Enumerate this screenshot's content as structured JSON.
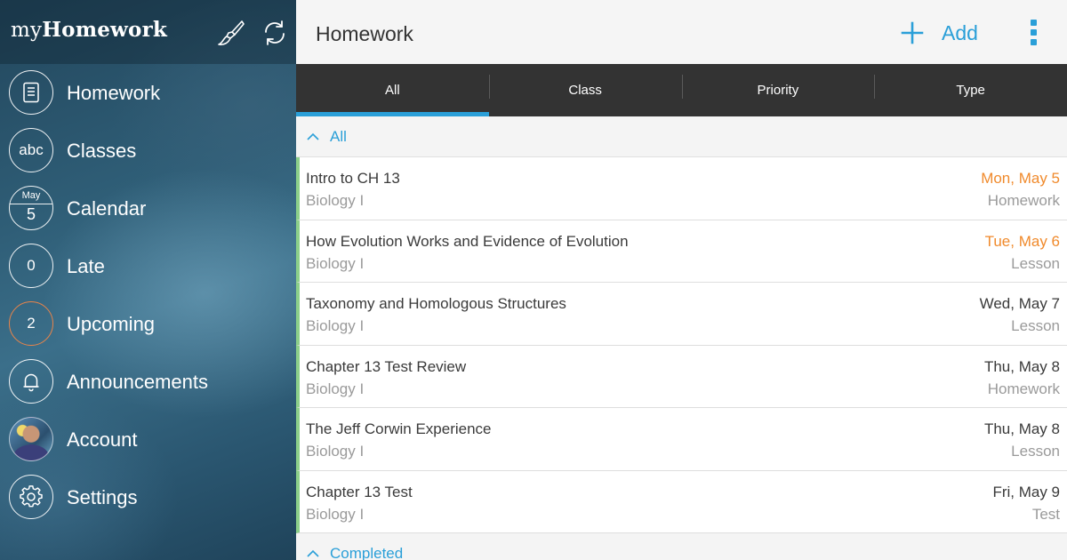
{
  "sidebar": {
    "brand_light": "my",
    "brand_bold": "Homework",
    "header_icons": [
      "paintbrush-icon",
      "sync-icon"
    ],
    "items": [
      {
        "id": "homework",
        "label": "Homework",
        "icon": "homework-list-icon"
      },
      {
        "id": "classes",
        "label": "Classes",
        "badge": "abc"
      },
      {
        "id": "calendar",
        "label": "Calendar",
        "cal_month": "May",
        "cal_day": "5"
      },
      {
        "id": "late",
        "label": "Late",
        "count": "0"
      },
      {
        "id": "upcoming",
        "label": "Upcoming",
        "count": "2",
        "count_color": "#e8844a"
      },
      {
        "id": "announcements",
        "label": "Announcements",
        "icon": "bell-icon"
      },
      {
        "id": "account",
        "label": "Account",
        "icon": "avatar"
      },
      {
        "id": "settings",
        "label": "Settings",
        "icon": "gear-icon"
      }
    ]
  },
  "header": {
    "title": "Homework",
    "add_label": "Add",
    "more_icon": "more-vertical-icon"
  },
  "tabs": [
    {
      "label": "All",
      "active": true
    },
    {
      "label": "Class",
      "active": false
    },
    {
      "label": "Priority",
      "active": false
    },
    {
      "label": "Type",
      "active": false
    }
  ],
  "sections": {
    "all_label": "All",
    "completed_label": "Completed"
  },
  "rows": [
    {
      "title": "Intro to CH 13",
      "class": "Biology I",
      "date": "Mon, May 5",
      "type": "Homework",
      "due_soon": true
    },
    {
      "title": "How Evolution Works and Evidence of Evolution",
      "class": "Biology I",
      "date": "Tue, May 6",
      "type": "Lesson",
      "due_soon": true
    },
    {
      "title": "Taxonomy and Homologous Structures",
      "class": "Biology I",
      "date": "Wed, May 7",
      "type": "Lesson",
      "due_soon": false
    },
    {
      "title": "Chapter 13 Test Review",
      "class": "Biology I",
      "date": "Thu, May 8",
      "type": "Homework",
      "due_soon": false
    },
    {
      "title": "The Jeff Corwin Experience",
      "class": "Biology I",
      "date": "Thu, May 8",
      "type": "Lesson",
      "due_soon": false
    },
    {
      "title": "Chapter 13 Test",
      "class": "Biology I",
      "date": "Fri, May 9",
      "type": "Test",
      "due_soon": false
    }
  ],
  "colors": {
    "accent": "#2a9fd8",
    "due_soon": "#f08a2c",
    "class_stripe": "#8ccf8a",
    "tab_bar": "#333333"
  }
}
